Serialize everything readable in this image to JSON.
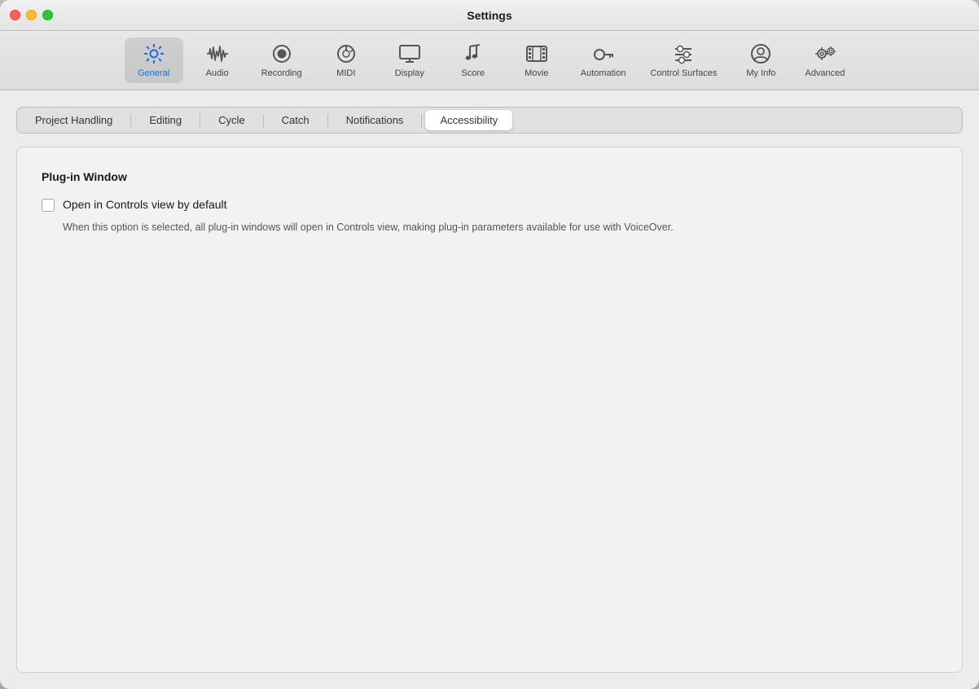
{
  "window": {
    "title": "Settings"
  },
  "toolbar": {
    "items": [
      {
        "id": "general",
        "label": "General",
        "icon": "gear-settings",
        "active": true
      },
      {
        "id": "audio",
        "label": "Audio",
        "icon": "audio-waveform",
        "active": false
      },
      {
        "id": "recording",
        "label": "Recording",
        "icon": "recording-circle",
        "active": false
      },
      {
        "id": "midi",
        "label": "MIDI",
        "icon": "midi-dial",
        "active": false
      },
      {
        "id": "display",
        "label": "Display",
        "icon": "display-monitor",
        "active": false
      },
      {
        "id": "score",
        "label": "Score",
        "icon": "score-notes",
        "active": false
      },
      {
        "id": "movie",
        "label": "Movie",
        "icon": "movie-film",
        "active": false
      },
      {
        "id": "automation",
        "label": "Automation",
        "icon": "automation-path",
        "active": false
      },
      {
        "id": "control-surfaces",
        "label": "Control Surfaces",
        "icon": "control-sliders",
        "active": false
      },
      {
        "id": "my-info",
        "label": "My Info",
        "icon": "person-circle",
        "active": false
      },
      {
        "id": "advanced",
        "label": "Advanced",
        "icon": "advanced-gear",
        "active": false
      }
    ]
  },
  "subtabs": {
    "items": [
      {
        "id": "project-handling",
        "label": "Project Handling",
        "active": false
      },
      {
        "id": "editing",
        "label": "Editing",
        "active": false
      },
      {
        "id": "cycle",
        "label": "Cycle",
        "active": false
      },
      {
        "id": "catch",
        "label": "Catch",
        "active": false
      },
      {
        "id": "notifications",
        "label": "Notifications",
        "active": false
      },
      {
        "id": "accessibility",
        "label": "Accessibility",
        "active": true
      }
    ]
  },
  "panel": {
    "section_title": "Plug-in Window",
    "checkbox": {
      "label": "Open in Controls view by default",
      "checked": false,
      "description": "When this option is selected, all plug-in windows will open in Controls view, making plug-in parameters available for use with VoiceOver."
    }
  },
  "traffic_lights": {
    "close": "close",
    "minimize": "minimize",
    "maximize": "maximize"
  }
}
